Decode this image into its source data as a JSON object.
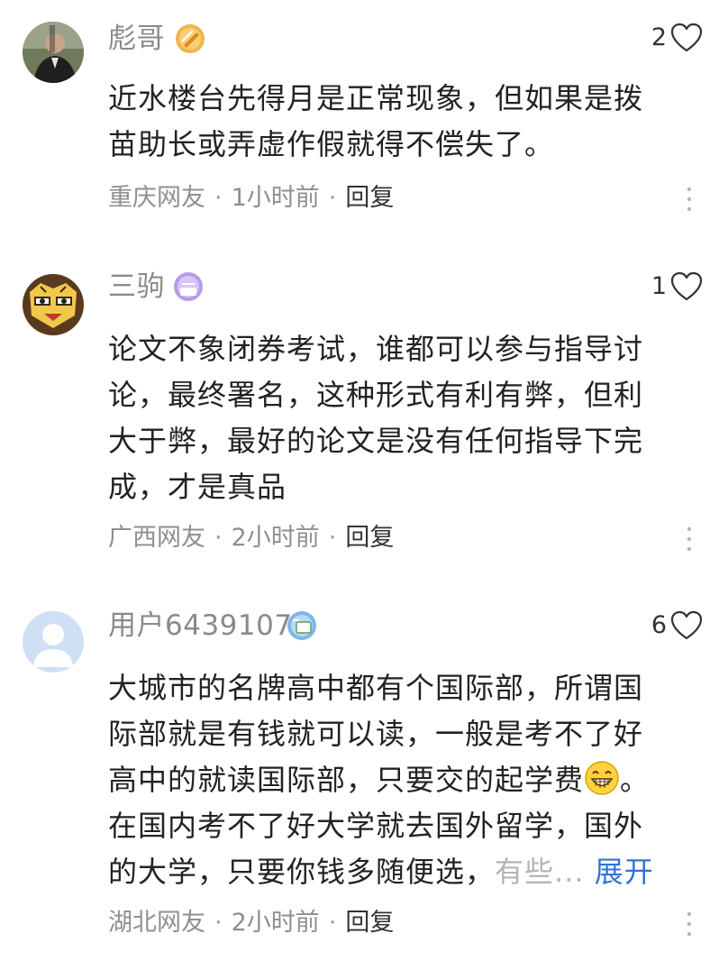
{
  "comments": [
    {
      "username": "彪哥",
      "badge_level": "90",
      "likes": "2",
      "body": "近水楼台先得月是正常现象，但如果是拨苗助长或弄虚作假就得不偿失了。",
      "location": "重庆网友",
      "time": "1小时前",
      "reply": "回复"
    },
    {
      "username": "三驹",
      "badge_level": "100",
      "likes": "1",
      "body": "论文不象闭券考试，谁都可以参与指导讨论，最终署名，这种形式有利有弊，但利大于弊，最好的论文是没有任何指导下完成，才是真品",
      "location": "广西网友",
      "time": "2小时前",
      "reply": "回复"
    },
    {
      "username": "用户6439107",
      "badge_level": "7",
      "likes": "6",
      "body_part1": "大城市的名牌高中都有个国际部，所谓国际部就是有钱就可以读，一般是考不了好高中的就读国际部，只要交的起学费",
      "body_part2": "。在国内考不了好大学就去国外留学，国外的大学，只要你钱多随便选，",
      "body_faded": "有些...",
      "expand": "展开",
      "location": "湖北网友",
      "time": "2小时前",
      "reply": "回复"
    }
  ],
  "separator": "·",
  "colors": {
    "username": "#8a8a8a",
    "meta": "#8f8f8f",
    "link": "#2f74d6"
  }
}
